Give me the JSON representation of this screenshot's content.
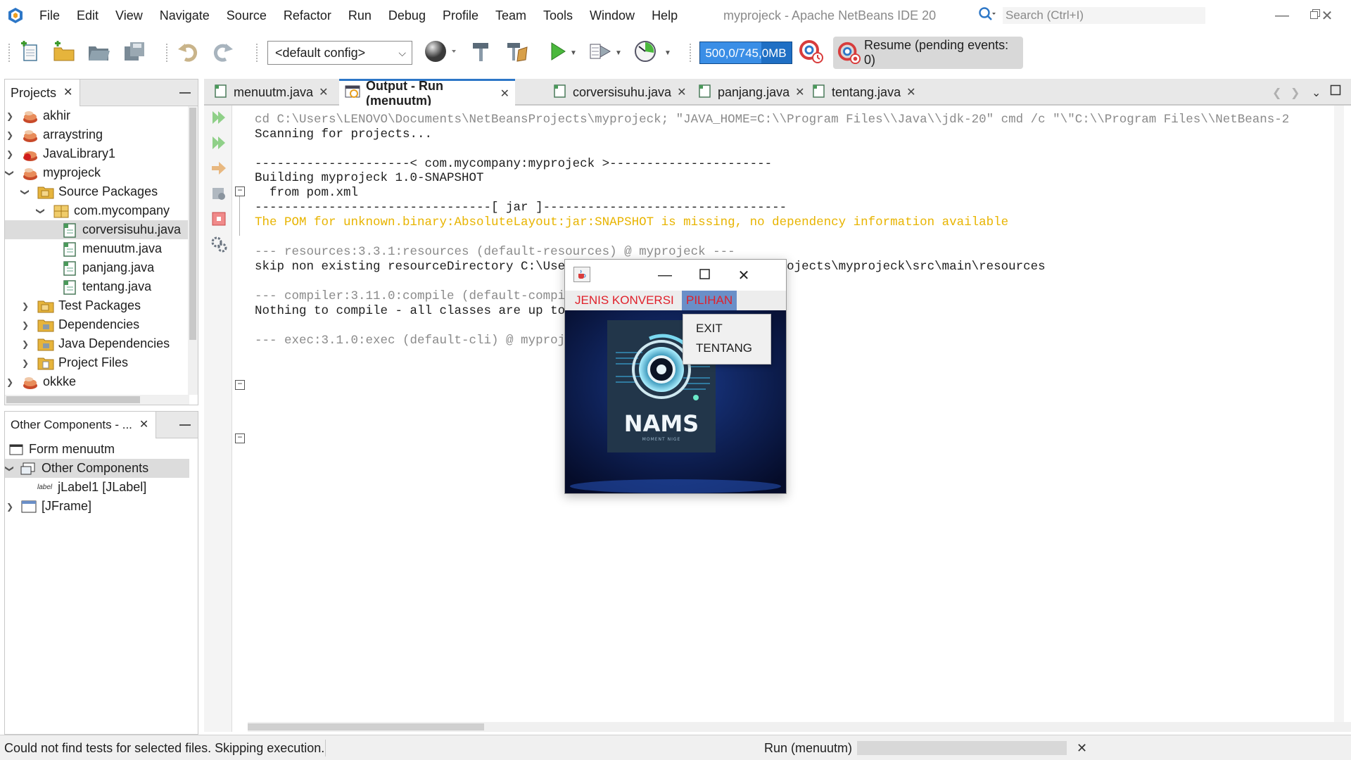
{
  "app": {
    "window_title": "myprojeck - Apache NetBeans IDE 20",
    "search_placeholder": "Search (Ctrl+I)"
  },
  "menubar": [
    "File",
    "Edit",
    "View",
    "Navigate",
    "Source",
    "Refactor",
    "Run",
    "Debug",
    "Profile",
    "Team",
    "Tools",
    "Window",
    "Help"
  ],
  "toolbar": {
    "config_value": "<default config>",
    "memory_label": "500,0/745,0MB",
    "memory_used_fraction": 0.67,
    "resume_label": "Resume (pending events: 0)"
  },
  "projects_panel": {
    "tab_label": "Projects",
    "tree": [
      {
        "label": "akhir",
        "icon": "project-icon"
      },
      {
        "label": "arraystring",
        "icon": "project-icon"
      },
      {
        "label": "JavaLibrary1",
        "icon": "library-project-icon"
      },
      {
        "label": "myprojeck",
        "icon": "project-icon"
      },
      {
        "label": "Source Packages",
        "icon": "package-folder-icon"
      },
      {
        "label": "com.mycompany",
        "icon": "package-icon"
      },
      {
        "label": "corversisuhu.java",
        "icon": "java-file-icon"
      },
      {
        "label": "menuutm.java",
        "icon": "java-file-icon"
      },
      {
        "label": "panjang.java",
        "icon": "java-file-icon"
      },
      {
        "label": "tentang.java",
        "icon": "java-file-icon"
      },
      {
        "label": "Test Packages",
        "icon": "package-folder-icon"
      },
      {
        "label": "Dependencies",
        "icon": "folder-icon"
      },
      {
        "label": "Java Dependencies",
        "icon": "folder-icon"
      },
      {
        "label": "Project Files",
        "icon": "folder-icon"
      },
      {
        "label": "okkke",
        "icon": "project-icon"
      }
    ]
  },
  "components_panel": {
    "tab_label": "Other Components - ...",
    "tree": [
      {
        "label": "Form menuutm"
      },
      {
        "label": "Other Components"
      },
      {
        "label": "jLabel1 [JLabel]",
        "badge": "label"
      },
      {
        "label": "[JFrame]"
      }
    ]
  },
  "editor_tabs": [
    {
      "label": "menuutm.java"
    },
    {
      "label": "Output - Run (menuutm)"
    },
    {
      "label": "corversisuhu.java"
    },
    {
      "label": "panjang.java"
    },
    {
      "label": "tentang.java"
    }
  ],
  "output": {
    "lines": [
      "cd C:\\Users\\LENOVO\\Documents\\NetBeansProjects\\myprojeck; \"JAVA_HOME=C:\\\\Program Files\\\\Java\\\\jdk-20\" cmd /c \"\\\"C:\\\\Program Files\\\\NetBeans-2",
      "Scanning for projects...",
      "",
      "---------------------< com.mycompany:myprojeck >----------------------",
      "Building myprojeck 1.0-SNAPSHOT",
      "  from pom.xml",
      "--------------------------------[ jar ]---------------------------------",
      "The POM for unknown.binary:AbsoluteLayout:jar:SNAPSHOT is missing, no dependency information available",
      "",
      "--- resources:3.3.1:resources (default-resources) @ myprojeck ---",
      "skip non existing resourceDirectory C:\\Users\\LENOVO\\Documents\\NetBeansProjects\\myprojeck\\src\\main\\resources",
      "",
      "--- compiler:3.11.0:compile (default-compile) @ myprojeck ---",
      "Nothing to compile - all classes are up to date",
      "",
      "--- exec:3.1.0:exec (default-cli) @ myprojeck ---"
    ]
  },
  "java_window": {
    "menus": [
      "JENIS KONVERSI",
      "PILIHAN"
    ],
    "popup_items": [
      "EXIT",
      "TENTANG"
    ],
    "logo_text": "NAMS",
    "logo_subtext": "MOMENT NIGE"
  },
  "statusbar": {
    "message": "Could not find tests for selected files. Skipping execution.",
    "task": "Run (menuutm)"
  },
  "colors": {
    "accent": "#2d77c7",
    "warning_text": "#e8b400",
    "memory_bar": "#1f6fc4",
    "java_menu_text": "#e0202a"
  }
}
